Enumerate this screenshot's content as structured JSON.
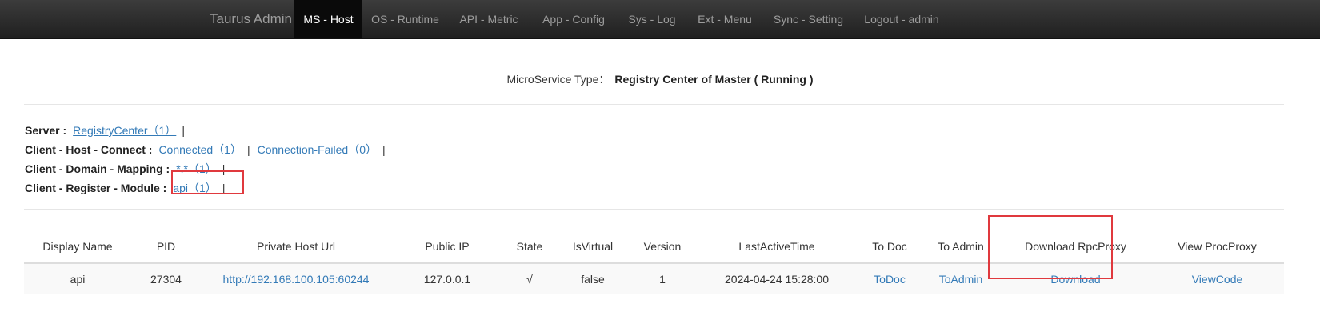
{
  "nav": {
    "brand": "Taurus Admin",
    "items": [
      {
        "label": "MS - Host",
        "active": true
      },
      {
        "label": "OS - Runtime"
      },
      {
        "label": "API - Metric"
      },
      {
        "label": "App - Config"
      },
      {
        "label": "Sys - Log"
      },
      {
        "label": "Ext - Menu"
      },
      {
        "label": "Sync - Setting"
      },
      {
        "label": "Logout - admin"
      }
    ]
  },
  "service_type": {
    "label": "MicroService Type：",
    "value": "Registry Center of Master ( Running )"
  },
  "info": {
    "server": {
      "key": "Server :",
      "links": [
        "RegistryCenter（1）"
      ]
    },
    "host_connect": {
      "key": "Client - Host - Connect :",
      "links": [
        "Connected（1）",
        "Connection-Failed（0）"
      ]
    },
    "domain_mapping": {
      "key": "Client - Domain - Mapping :",
      "links": [
        "*.*（1）"
      ]
    },
    "register_module": {
      "key": "Client - Register - Module :",
      "links": [
        "api（1）"
      ]
    },
    "separator": "|"
  },
  "table": {
    "headers": [
      "Display Name",
      "PID",
      "Private Host Url",
      "Public IP",
      "State",
      "IsVirtual",
      "Version",
      "LastActiveTime",
      "To Doc",
      "To Admin",
      "Download RpcProxy",
      "View ProcProxy"
    ],
    "rows": [
      {
        "display_name": "api",
        "pid": "27304",
        "private_host_url": "http://192.168.100.105:60244",
        "public_ip": "127.0.0.1",
        "state": "√",
        "is_virtual": "false",
        "version": "1",
        "last_active_time": "2024-04-24 15:28:00",
        "to_doc": "ToDoc",
        "to_admin": "ToAdmin",
        "download": "Download",
        "view_code": "ViewCode"
      }
    ]
  },
  "colors": {
    "navbar": "#222222",
    "link": "#337ab7",
    "highlight_box": "#e0393e"
  }
}
